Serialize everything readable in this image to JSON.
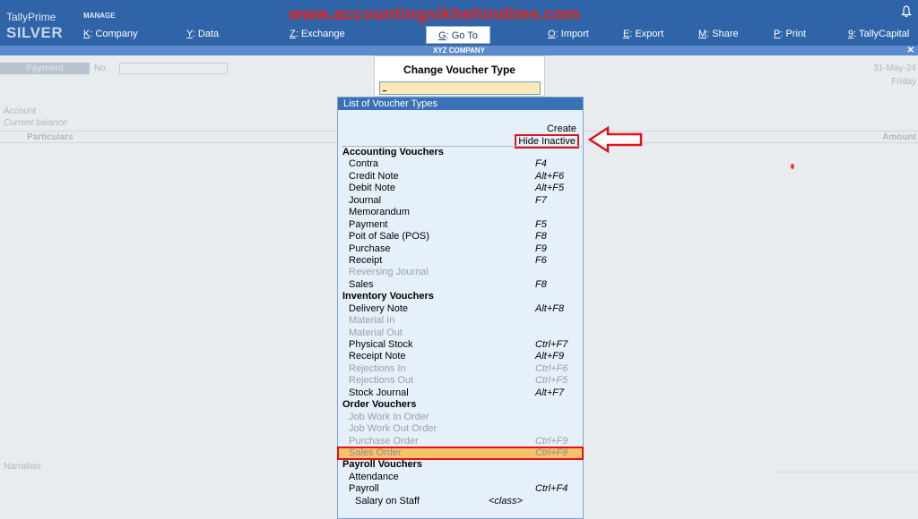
{
  "app": {
    "name": "TallyPrime",
    "edition": "SILVER",
    "menu_group": "MANAGE",
    "watermark": "www.accountingsikhehindime.com"
  },
  "menu": [
    {
      "key": "K",
      "label": ": Company"
    },
    {
      "key": "Y",
      "label": ": Data"
    },
    {
      "key": "Z",
      "label": ": Exchange"
    },
    {
      "key": "G",
      "label": ": Go To"
    },
    {
      "key": "O",
      "label": ": Import"
    },
    {
      "key": "E",
      "label": ": Export"
    },
    {
      "key": "M",
      "label": ": Share"
    },
    {
      "key": "P",
      "label": ": Print"
    },
    {
      "key": "9",
      "label": ": TallyCapital"
    }
  ],
  "company": "XYZ COMPANY",
  "voucher": {
    "type_label": "Payment",
    "no_label": "No.",
    "date": "31-May-24",
    "day": "Friday",
    "account_label": "Account",
    "current_balance_label": "Current balance",
    "particulars_label": "Particulars",
    "amount_label": "Amount",
    "narration_label": "Narration:"
  },
  "change_voucher": {
    "title": "Change Voucher Type"
  },
  "list": {
    "title": "List of Voucher Types",
    "create_label": "Create",
    "hide_inactive_label": "Hide Inactive",
    "rows": [
      {
        "label": "Accounting Vouchers",
        "shortcut": "",
        "kind": "group"
      },
      {
        "label": "Contra",
        "shortcut": "F4",
        "kind": "item"
      },
      {
        "label": "Credit Note",
        "shortcut": "Alt+F6",
        "kind": "item"
      },
      {
        "label": "Debit Note",
        "shortcut": "Alt+F5",
        "kind": "item"
      },
      {
        "label": "Journal",
        "shortcut": "F7",
        "kind": "item"
      },
      {
        "label": "Memorandum",
        "shortcut": "",
        "kind": "item"
      },
      {
        "label": "Payment",
        "shortcut": "F5",
        "kind": "item"
      },
      {
        "label": "Poit of Sale (POS)",
        "shortcut": "F8",
        "kind": "item"
      },
      {
        "label": "Purchase",
        "shortcut": "F9",
        "kind": "item"
      },
      {
        "label": "Receipt",
        "shortcut": "F6",
        "kind": "item"
      },
      {
        "label": "Reversing Journal",
        "shortcut": "",
        "kind": "inactive"
      },
      {
        "label": "Sales",
        "shortcut": "F8",
        "kind": "item"
      },
      {
        "label": "Inventory Vouchers",
        "shortcut": "",
        "kind": "group"
      },
      {
        "label": "Delivery Note",
        "shortcut": "Alt+F8",
        "kind": "item"
      },
      {
        "label": "Material In",
        "shortcut": "",
        "kind": "inactive"
      },
      {
        "label": "Material Out",
        "shortcut": "",
        "kind": "inactive"
      },
      {
        "label": "Physical Stock",
        "shortcut": "Ctrl+F7",
        "kind": "item"
      },
      {
        "label": "Receipt Note",
        "shortcut": "Alt+F9",
        "kind": "item"
      },
      {
        "label": "Rejections In",
        "shortcut": "Ctrl+F6",
        "kind": "inactive"
      },
      {
        "label": "Rejections Out",
        "shortcut": "Ctrl+F5",
        "kind": "inactive"
      },
      {
        "label": "Stock Journal",
        "shortcut": "Alt+F7",
        "kind": "item"
      },
      {
        "label": "Order Vouchers",
        "shortcut": "",
        "kind": "group"
      },
      {
        "label": "Job Work In Order",
        "shortcut": "",
        "kind": "inactive"
      },
      {
        "label": "Job Work Out Order",
        "shortcut": "",
        "kind": "inactive"
      },
      {
        "label": "Purchase Order",
        "shortcut": "Ctrl+F9",
        "kind": "inactive"
      },
      {
        "label": "Sales Order",
        "shortcut": "Ctrl+F8",
        "kind": "selected"
      },
      {
        "label": "Payroll Vouchers",
        "shortcut": "",
        "kind": "group"
      },
      {
        "label": "Attendance",
        "shortcut": "",
        "kind": "item"
      },
      {
        "label": "Payroll",
        "shortcut": "Ctrl+F4",
        "kind": "item"
      },
      {
        "label": "Salary on Staff",
        "shortcut": "<class>",
        "kind": "child2"
      }
    ]
  },
  "colors": {
    "topbar": "#2f64a8",
    "list_header": "#3a70b4",
    "highlight_border": "#e0121a",
    "selected_row": "#f7c26a"
  },
  "icons": {
    "bell": "bell-icon",
    "close": "close-icon",
    "arrow": "arrow-left-icon"
  }
}
